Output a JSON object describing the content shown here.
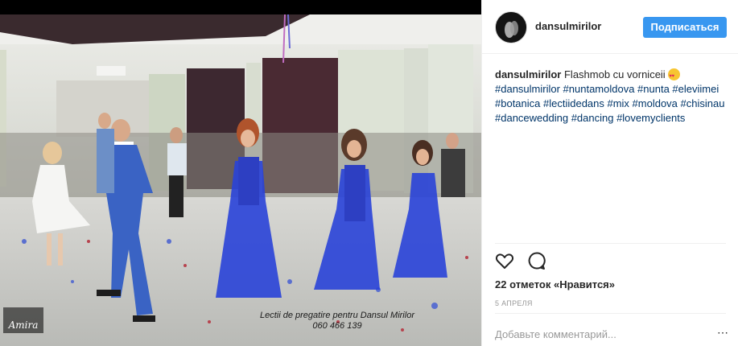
{
  "post": {
    "photo": {
      "watermark_logo": "Amira",
      "overlay_line1": "Lectii de pregatire pentru Dansul Mirilor",
      "overlay_line2": "060 466 139"
    },
    "author": {
      "username": "dansulmirilor"
    },
    "follow_label": "Подписаться",
    "caption": {
      "username": "dansulmirilor",
      "text": "Flashmob cu vorniceii",
      "emoji": "heart-eyes-emoji",
      "hashtags": "#dansulmirilor #nuntamoldova #nunta #eleviimei #botanica #lectiidedans #mix #moldova #chisinau #dancewedding #dancing #lovemyclients"
    },
    "likes_text": "22 отметок «Нравится»",
    "date_text": "5 АПРЕЛЯ",
    "comment_placeholder": "Добавьте комментарий...",
    "more_label": "⋯",
    "icons": [
      "heart-icon",
      "comment-icon",
      "more-icon"
    ]
  }
}
